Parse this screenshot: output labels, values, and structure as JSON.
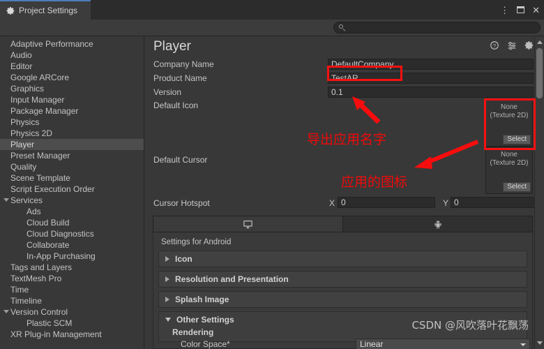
{
  "window": {
    "tab_label": "Project Settings",
    "tab_icon": "gear-icon",
    "menu_icon": "kebab-menu-icon",
    "maximize_icon": "maximize-icon",
    "close_icon": "close-icon",
    "close_glyph": "✕",
    "kebab_glyph": "⋮"
  },
  "search": {
    "value": "",
    "placeholder": "",
    "icon": "search-icon"
  },
  "sidebar": {
    "items": [
      {
        "label": "Adaptive Performance",
        "indent": false,
        "expander": false,
        "selected": false
      },
      {
        "label": "Audio",
        "indent": false,
        "expander": false,
        "selected": false
      },
      {
        "label": "Editor",
        "indent": false,
        "expander": false,
        "selected": false
      },
      {
        "label": "Google ARCore",
        "indent": false,
        "expander": false,
        "selected": false
      },
      {
        "label": "Graphics",
        "indent": false,
        "expander": false,
        "selected": false
      },
      {
        "label": "Input Manager",
        "indent": false,
        "expander": false,
        "selected": false
      },
      {
        "label": "Package Manager",
        "indent": false,
        "expander": false,
        "selected": false
      },
      {
        "label": "Physics",
        "indent": false,
        "expander": false,
        "selected": false
      },
      {
        "label": "Physics 2D",
        "indent": false,
        "expander": false,
        "selected": false
      },
      {
        "label": "Player",
        "indent": false,
        "expander": false,
        "selected": true
      },
      {
        "label": "Preset Manager",
        "indent": false,
        "expander": false,
        "selected": false
      },
      {
        "label": "Quality",
        "indent": false,
        "expander": false,
        "selected": false
      },
      {
        "label": "Scene Template",
        "indent": false,
        "expander": false,
        "selected": false
      },
      {
        "label": "Script Execution Order",
        "indent": false,
        "expander": false,
        "selected": false
      },
      {
        "label": "Services",
        "indent": false,
        "expander": true,
        "selected": false
      },
      {
        "label": "Ads",
        "indent": true,
        "expander": false,
        "selected": false
      },
      {
        "label": "Cloud Build",
        "indent": true,
        "expander": false,
        "selected": false
      },
      {
        "label": "Cloud Diagnostics",
        "indent": true,
        "expander": false,
        "selected": false
      },
      {
        "label": "Collaborate",
        "indent": true,
        "expander": false,
        "selected": false
      },
      {
        "label": "In-App Purchasing",
        "indent": true,
        "expander": false,
        "selected": false
      },
      {
        "label": "Tags and Layers",
        "indent": false,
        "expander": false,
        "selected": false
      },
      {
        "label": "TextMesh Pro",
        "indent": false,
        "expander": false,
        "selected": false
      },
      {
        "label": "Time",
        "indent": false,
        "expander": false,
        "selected": false
      },
      {
        "label": "Timeline",
        "indent": false,
        "expander": false,
        "selected": false
      },
      {
        "label": "Version Control",
        "indent": false,
        "expander": true,
        "selected": false
      },
      {
        "label": "Plastic SCM",
        "indent": true,
        "expander": false,
        "selected": false
      },
      {
        "label": "XR Plug-in Management",
        "indent": false,
        "expander": false,
        "selected": false
      }
    ]
  },
  "player": {
    "title": "Player",
    "header_icons": [
      {
        "name": "help-icon"
      },
      {
        "name": "preset-icon"
      },
      {
        "name": "gear-icon"
      }
    ],
    "fields": [
      {
        "label": "Company Name",
        "value": "DefaultCompany"
      },
      {
        "label": "Product Name",
        "value": "TestAR"
      },
      {
        "label": "Version",
        "value": "0.1"
      }
    ],
    "default_icon": {
      "label": "Default Icon",
      "slot_line1": "None",
      "slot_line2": "(Texture 2D)",
      "select_label": "Select"
    },
    "default_cursor": {
      "label": "Default Cursor",
      "slot_line1": "None",
      "slot_line2": "(Texture 2D)",
      "select_label": "Select"
    },
    "cursor_hotspot": {
      "label": "Cursor Hotspot",
      "x_label": "X",
      "x_value": "0",
      "y_label": "Y",
      "y_value": "0"
    },
    "platform_tabs": [
      {
        "icon": "monitor-icon",
        "active": true
      },
      {
        "icon": "android-icon",
        "active": false
      }
    ],
    "settings_for": "Settings for Android",
    "foldouts": [
      {
        "label": "Icon",
        "open": false
      },
      {
        "label": "Resolution and Presentation",
        "open": false
      },
      {
        "label": "Splash Image",
        "open": false
      },
      {
        "label": "Other Settings",
        "open": true
      }
    ],
    "other_settings": {
      "section": "Rendering",
      "color_space_label": "Color Space*",
      "color_space_value": "Linear"
    }
  },
  "annotations": {
    "accent_color": "#f70d0d",
    "callout_1": "导出应用名字",
    "callout_2": "应用的图标"
  },
  "watermark": {
    "text": "CSDN @风吹落叶花飘荡"
  }
}
